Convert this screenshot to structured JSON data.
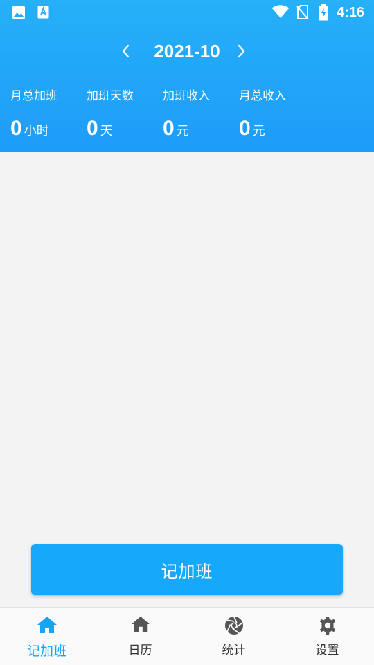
{
  "status_bar": {
    "time": "4:16",
    "left_icons": [
      "image-icon",
      "text-a-icon"
    ],
    "right_icons": [
      "wifi-icon",
      "no-sim-icon",
      "battery-charging-icon"
    ]
  },
  "header": {
    "month": "2021-10",
    "prev_icon": "chevron-left-icon",
    "next_icon": "chevron-right-icon",
    "stats": [
      {
        "label": "月总加班",
        "value": "0",
        "unit": "小时"
      },
      {
        "label": "加班天数",
        "value": "0",
        "unit": "天"
      },
      {
        "label": "加班收入",
        "value": "0",
        "unit": "元"
      },
      {
        "label": "月总收入",
        "value": "0",
        "unit": "元"
      }
    ]
  },
  "main": {
    "record_button_label": "记加班"
  },
  "bottom_nav": {
    "tabs": [
      {
        "label": "记加班",
        "icon": "home-icon",
        "active": true
      },
      {
        "label": "日历",
        "icon": "home-icon",
        "active": false
      },
      {
        "label": "统计",
        "icon": "aperture-icon",
        "active": false
      },
      {
        "label": "设置",
        "icon": "gear-icon",
        "active": false
      }
    ]
  },
  "colors": {
    "header_top": "#25b0f8",
    "header_bottom": "#1e9cf9",
    "accent": "#16a9fb",
    "active_tab": "#16a5f5",
    "inactive_icon": "#555555",
    "background": "#f3f3f3"
  }
}
